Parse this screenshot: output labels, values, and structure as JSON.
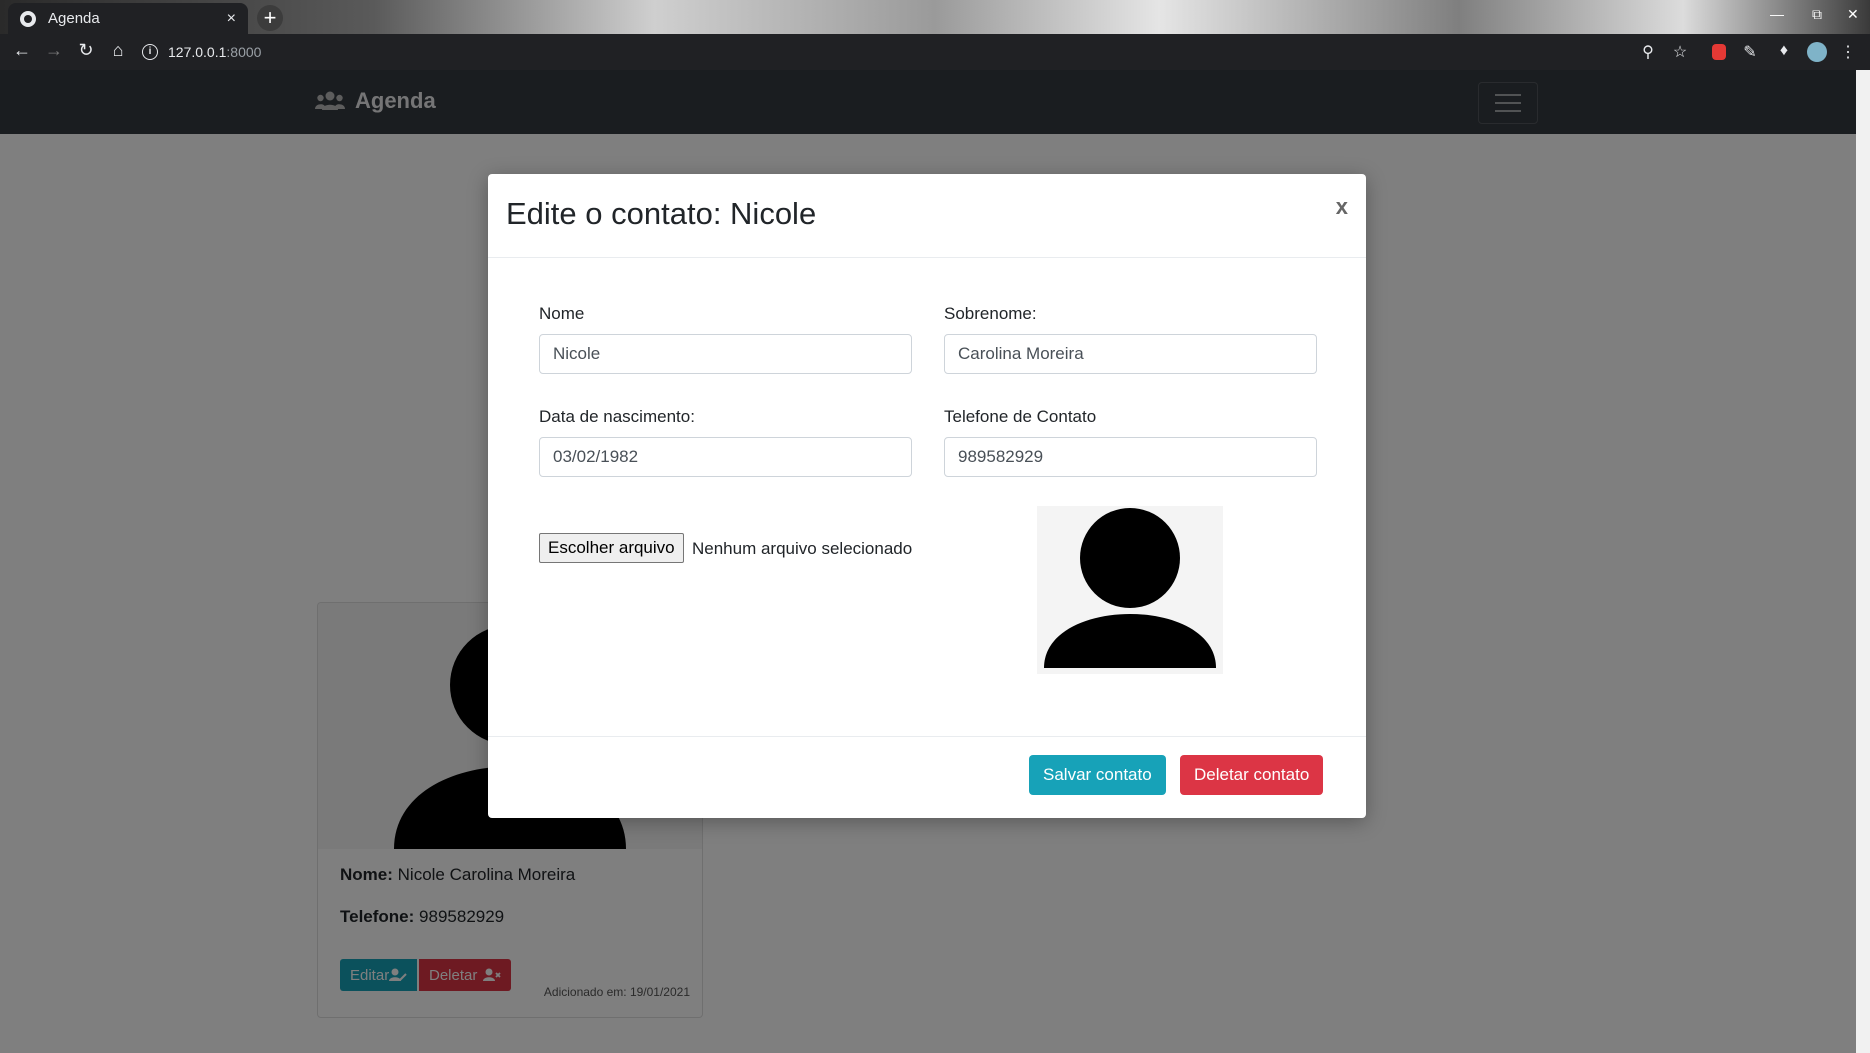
{
  "browser": {
    "tab_title": "Agenda",
    "tab_close": "×",
    "new_tab": "+",
    "url_host": "127.0.0.1",
    "url_port": ":8000"
  },
  "navbar": {
    "brand": "Agenda"
  },
  "card": {
    "name_label": "Nome:",
    "name_value": "Nicole Carolina Moreira",
    "phone_label": "Telefone:",
    "phone_value": "989582929",
    "edit_button": "Editar",
    "delete_button": "Deletar",
    "added": "Adicionado em: 19/01/2021"
  },
  "modal": {
    "title": "Edite o contato: Nicole",
    "close": "x",
    "fields": {
      "nome_label": "Nome",
      "nome_value": "Nicole",
      "sobrenome_label": "Sobrenome:",
      "sobrenome_value": "Carolina Moreira",
      "nascimento_label": "Data de nascimento:",
      "nascimento_value": "03/02/1982",
      "telefone_label": "Telefone de Contato",
      "telefone_value": "989582929"
    },
    "file_button": "Escolher arquivo",
    "file_status": "Nenhum arquivo selecionado",
    "save_button": "Salvar contato",
    "delete_button": "Deletar contato"
  },
  "colors": {
    "navbar": "#343a40",
    "info": "#17a2b8",
    "danger": "#dc3545"
  },
  "icons": {
    "brand": "users-icon",
    "avatar": "person-silhouette-icon"
  }
}
